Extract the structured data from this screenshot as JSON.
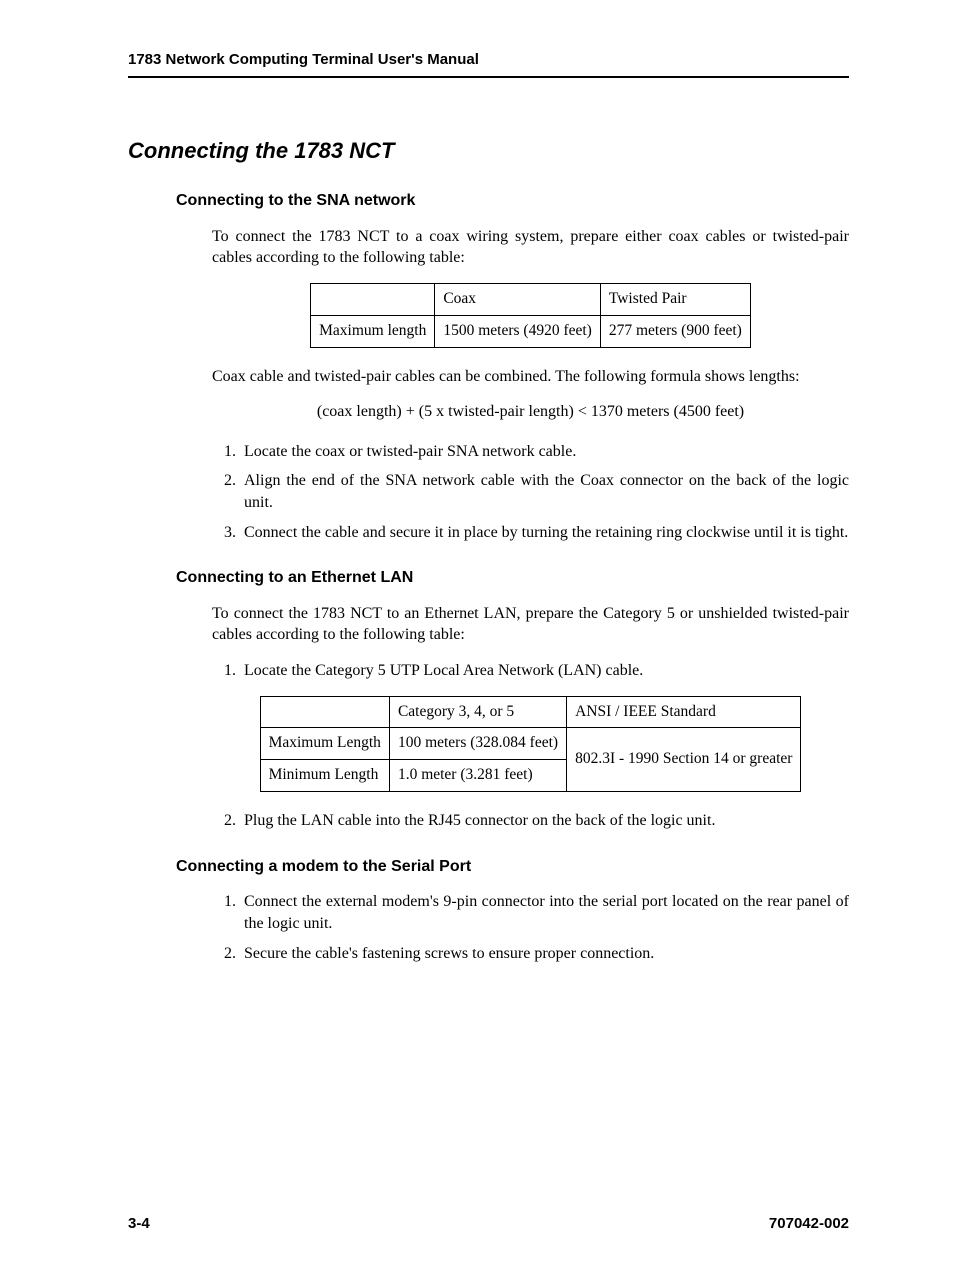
{
  "header": {
    "running_title": "1783 Network Computing Terminal User's Manual"
  },
  "main": {
    "title": "Connecting the 1783 NCT",
    "sna": {
      "heading": "Connecting to the SNA network",
      "intro": "To connect the 1783 NCT to a coax wiring system, prepare either coax cables or twisted-pair cables according to the following table:",
      "table": {
        "col_blank": "",
        "col_coax": "Coax",
        "col_tp": "Twisted Pair",
        "row_label": "Maximum length",
        "coax_val": "1500 meters (4920 feet)",
        "tp_val": "277 meters (900 feet)"
      },
      "combined_text": "Coax cable and twisted-pair cables can be combined. The following formula shows lengths:",
      "formula": "(coax length) + (5 x twisted-pair length) < 1370 meters (4500 feet)",
      "steps": [
        "Locate the coax or twisted-pair SNA network cable.",
        "Align the end of the SNA network cable with the Coax connector on the back of the logic unit.",
        "Connect the cable and secure it in place by turning the retaining ring clockwise until it is tight."
      ]
    },
    "lan": {
      "heading": "Connecting to an Ethernet LAN",
      "intro": "To connect the 1783 NCT to an Ethernet LAN, prepare the Category 5 or unshielded twisted-pair cables according to the following table:",
      "step1": "Locate the Category 5 UTP Local Area Network (LAN) cable.",
      "table": {
        "col_blank": "",
        "col_cat": "Category 3, 4, or 5",
        "col_std": "ANSI / IEEE Standard",
        "row1_label": "Maximum Length",
        "row1_cat": "100 meters (328.084 feet)",
        "std_val": "802.3I - 1990 Section 14 or greater",
        "row2_label": "Minimum Length",
        "row2_cat": "1.0 meter (3.281 feet)"
      },
      "step2": "Plug the LAN cable into the RJ45 connector on the back of the logic unit."
    },
    "modem": {
      "heading": "Connecting a modem to the Serial Port",
      "steps": [
        "Connect the external modem's 9-pin connector into the serial port located on the rear panel of the logic unit.",
        "Secure the cable's fastening screws to ensure proper connection."
      ]
    }
  },
  "footer": {
    "page": "3-4",
    "docnum": "707042-002"
  }
}
